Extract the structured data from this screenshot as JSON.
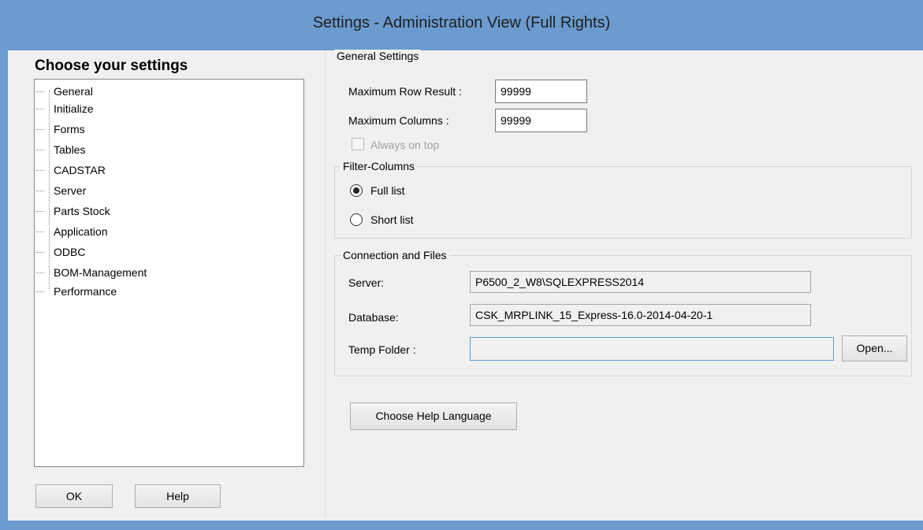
{
  "window": {
    "title": "Settings - Administration View (Full Rights)"
  },
  "sidebar": {
    "heading": "Choose your settings",
    "items": [
      {
        "label": "General"
      },
      {
        "label": "Initialize"
      },
      {
        "label": "Forms"
      },
      {
        "label": "Tables"
      },
      {
        "label": "CADSTAR"
      },
      {
        "label": "Server"
      },
      {
        "label": "Parts Stock"
      },
      {
        "label": "Application"
      },
      {
        "label": "ODBC"
      },
      {
        "label": "BOM-Management"
      },
      {
        "label": "Performance"
      }
    ],
    "ok_label": "OK",
    "help_label": "Help"
  },
  "general": {
    "group_label": "General Settings",
    "max_row_label": "Maximum Row Result :",
    "max_row_value": "99999",
    "max_cols_label": "Maximum Columns :",
    "max_cols_value": "99999",
    "always_on_top_label": "Always on top",
    "always_on_top_checked": false
  },
  "filter": {
    "group_label": "Filter-Columns",
    "options": [
      {
        "label": "Full list",
        "selected": true
      },
      {
        "label": "Short list",
        "selected": false
      }
    ]
  },
  "connection": {
    "group_label": "Connection and Files",
    "server_label": "Server:",
    "server_value": "P6500_2_W8\\SQLEXPRESS2014",
    "database_label": "Database:",
    "database_value": "CSK_MRPLINK_15_Express-16.0-2014-04-20-1",
    "temp_label": "Temp Folder :",
    "temp_value": "",
    "open_label": "Open..."
  },
  "help_language_label": "Choose Help Language",
  "colors": {
    "frame": "#6b9bcf",
    "client": "#f0f0f0",
    "focus_border": "#5a9bd8"
  }
}
